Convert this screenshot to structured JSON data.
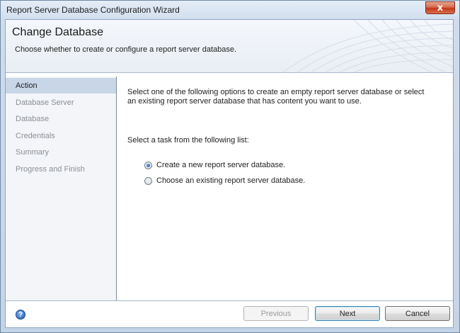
{
  "window": {
    "title": "Report Server Database Configuration Wizard",
    "close_glyph": "x"
  },
  "header": {
    "title": "Change Database",
    "subtitle": "Choose whether to create or configure a report server database."
  },
  "sidebar": {
    "items": [
      {
        "label": "Action",
        "active": true
      },
      {
        "label": "Database Server",
        "active": false
      },
      {
        "label": "Database",
        "active": false
      },
      {
        "label": "Credentials",
        "active": false
      },
      {
        "label": "Summary",
        "active": false
      },
      {
        "label": "Progress and Finish",
        "active": false
      }
    ]
  },
  "main": {
    "intro": "Select one of the following options to create an empty report server database or select an existing report server database that has content you want to use.",
    "task_label": "Select a task from the following list:",
    "options": [
      {
        "label": "Create a new report server database.",
        "selected": true
      },
      {
        "label": "Choose an existing report server database.",
        "selected": false
      }
    ]
  },
  "footer": {
    "help_glyph": "?",
    "previous_label": "Previous",
    "next_label": "Next",
    "cancel_label": "Cancel"
  },
  "icons": {
    "help": "help-icon",
    "close": "close-icon"
  },
  "colors": {
    "active_item_bg": "#c8d6e8",
    "inactive_item_text": "#8a8f96",
    "close_button": "#c2371b"
  }
}
